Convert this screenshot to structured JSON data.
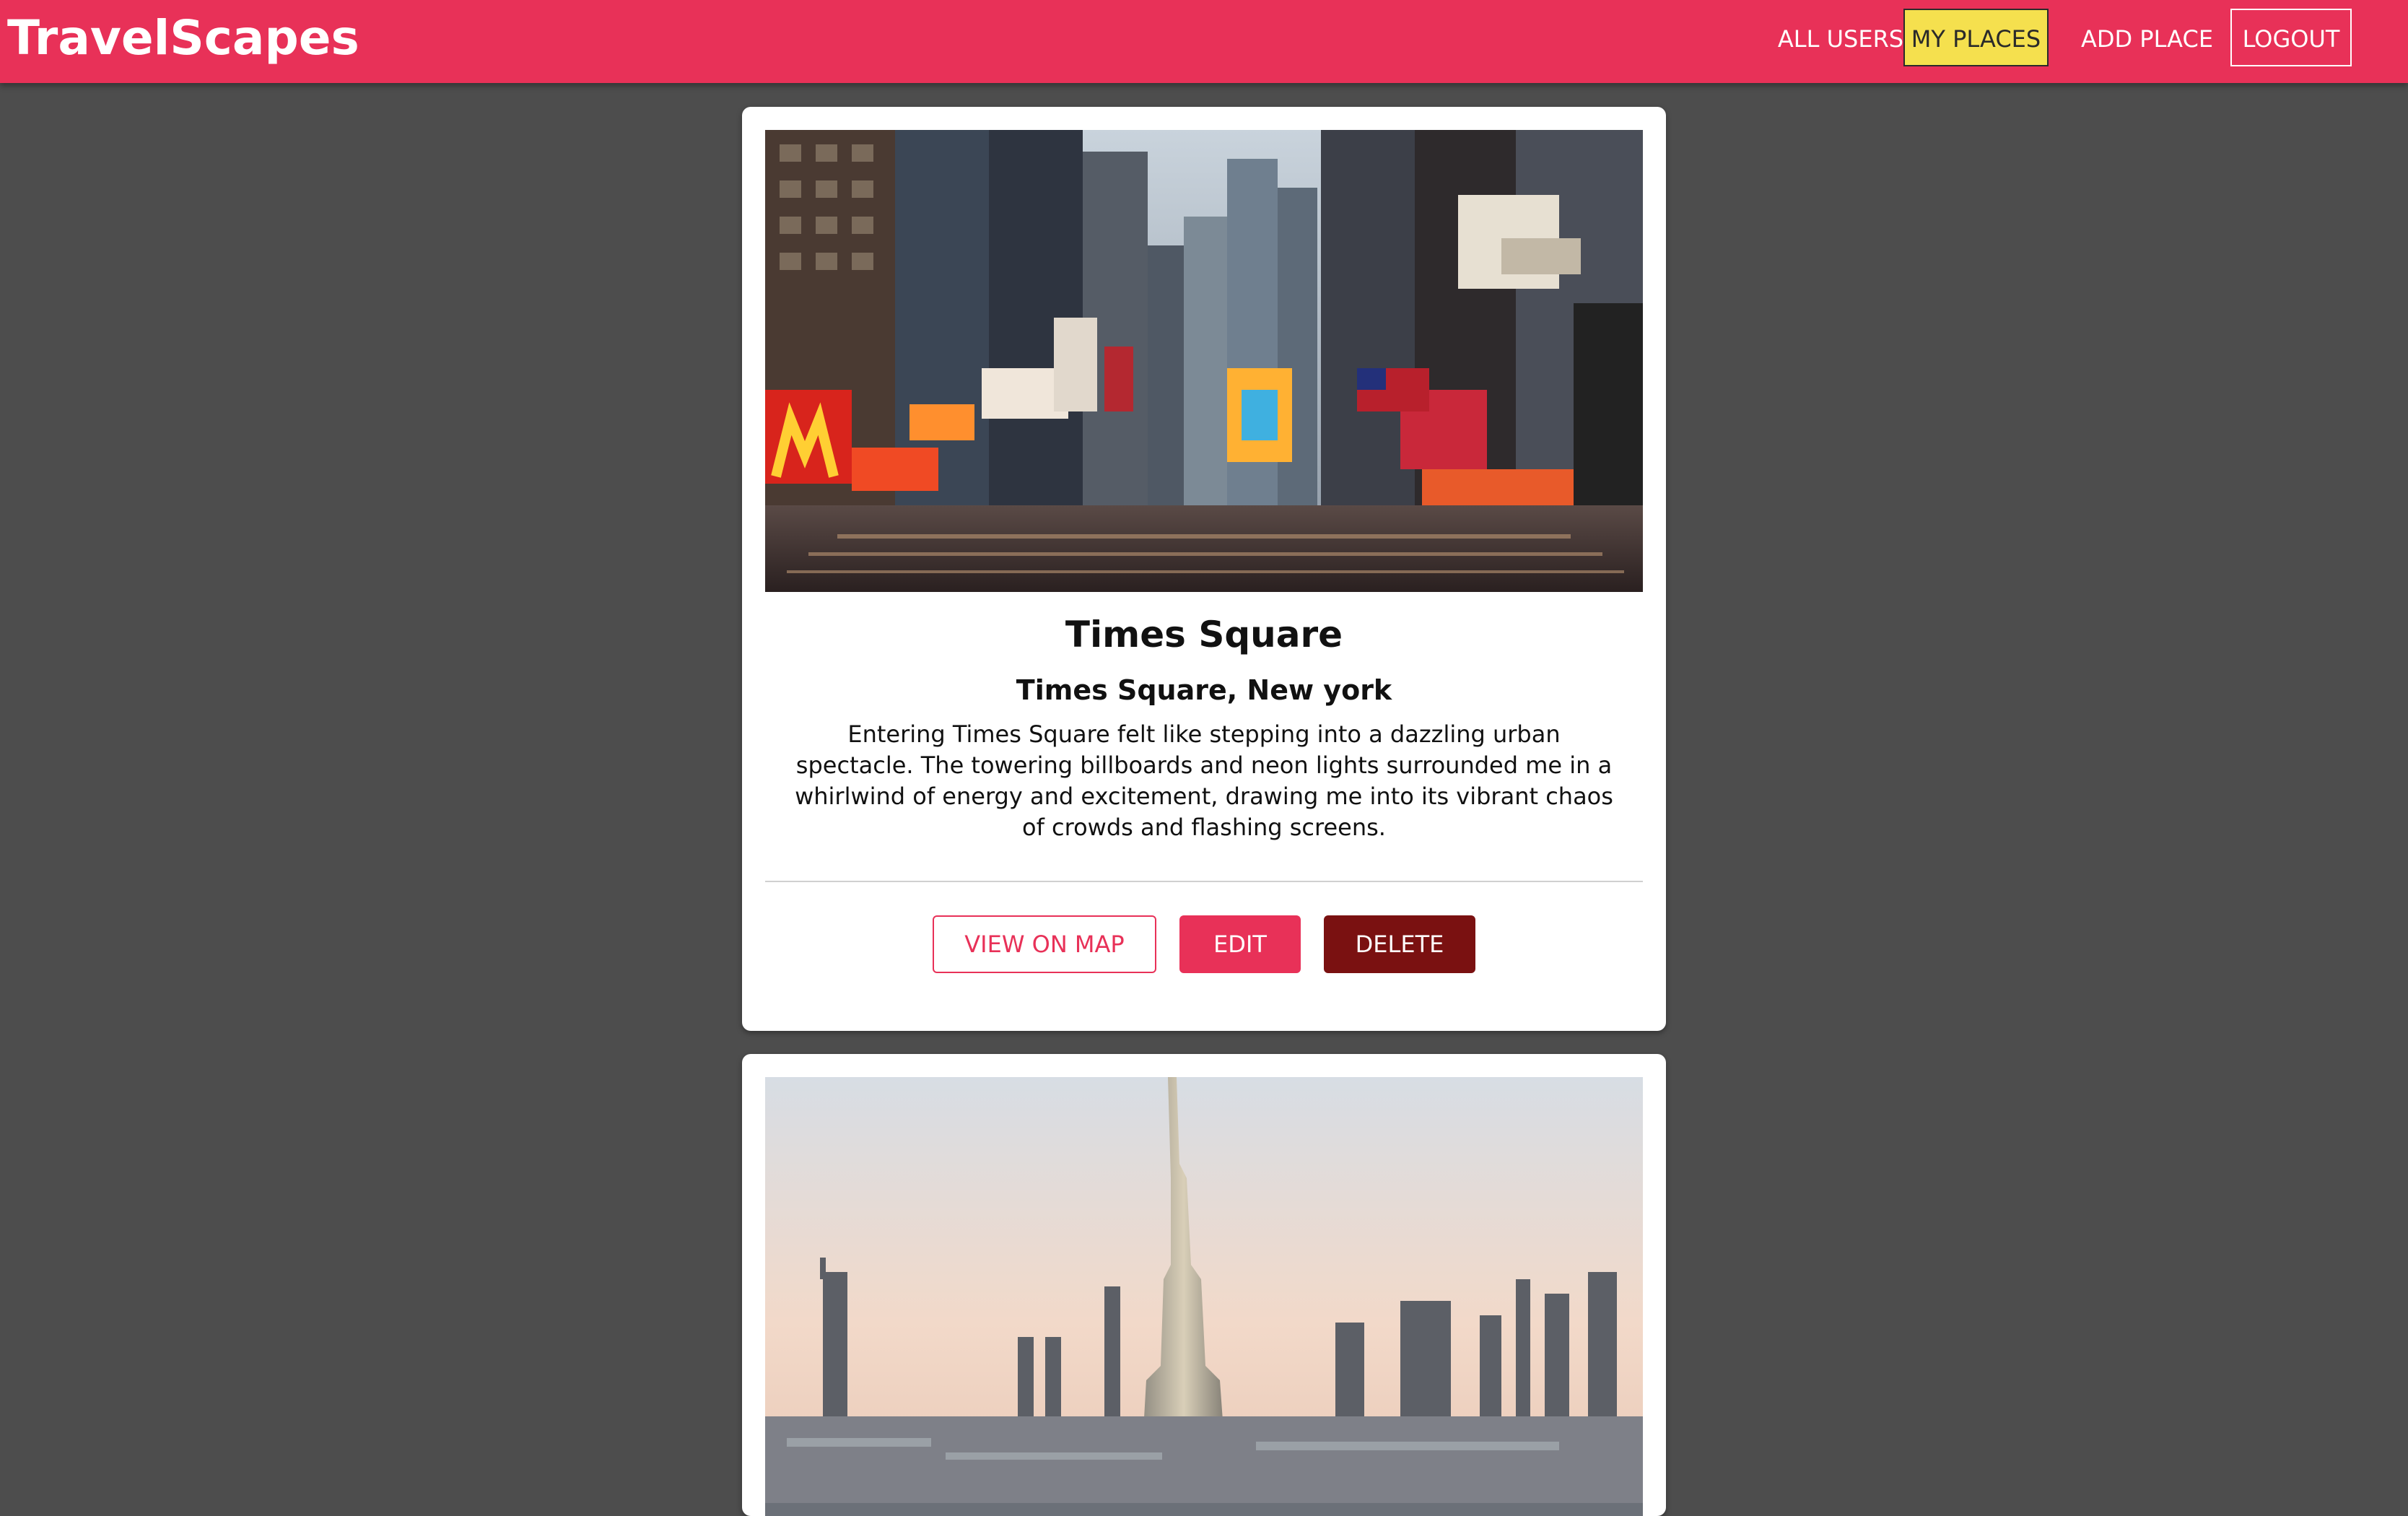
{
  "header": {
    "brand": "TravelScapes",
    "nav": [
      {
        "label": "ALL USERS"
      },
      {
        "label": "MY PLACES"
      },
      {
        "label": "ADD PLACE"
      },
      {
        "label": "LOGOUT"
      }
    ]
  },
  "places": [
    {
      "title": "Times Square",
      "address": "Times Square, New york",
      "description": "Entering Times Square felt like stepping into a dazzling urban spectacle. The towering billboards and neon lights surrounded me in a whirlwind of energy and excitement, drawing me into its vibrant chaos of crowds and flashing screens.",
      "actions": {
        "view_on_map": "VIEW ON MAP",
        "edit": "EDIT",
        "delete": "DELETE"
      }
    },
    {
      "title": "",
      "address": "",
      "description": ""
    }
  ],
  "colors": {
    "header_bg": "#e83158",
    "active_nav_bg": "#f5e04e",
    "page_bg": "#4d4d4d",
    "edit_button": "#e83158",
    "delete_button": "#7a1111"
  }
}
